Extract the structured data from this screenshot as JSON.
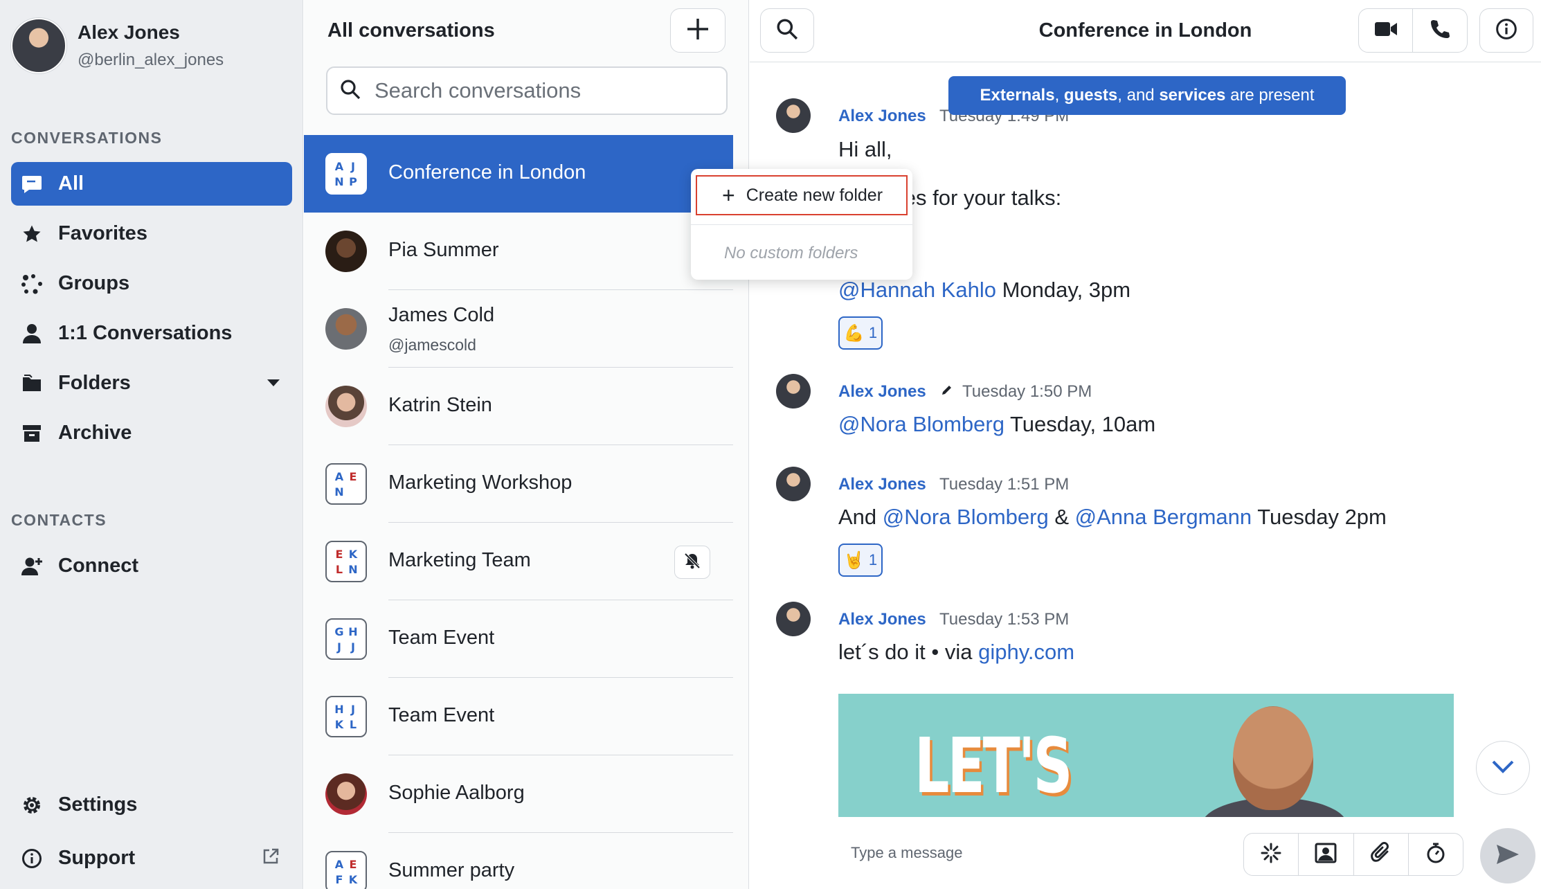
{
  "colors": {
    "accent": "#2d66c6",
    "highlight_box": "#d9412f"
  },
  "profile": {
    "name": "Alex Jones",
    "handle": "@berlin_alex_jones"
  },
  "sidebar": {
    "conversations_label": "CONVERSATIONS",
    "contacts_label": "CONTACTS",
    "items": [
      {
        "label": "All",
        "icon": "chat-bubble-icon",
        "active": true
      },
      {
        "label": "Favorites",
        "icon": "star-icon"
      },
      {
        "label": "Groups",
        "icon": "groups-dots-icon"
      },
      {
        "label": "1:1 Conversations",
        "icon": "person-icon"
      },
      {
        "label": "Folders",
        "icon": "folder-icon"
      },
      {
        "label": "Archive",
        "icon": "archive-box-icon"
      }
    ],
    "contacts": [
      {
        "label": "Connect",
        "icon": "add-person-icon"
      }
    ],
    "settings_label": "Settings",
    "support_label": "Support"
  },
  "list": {
    "title": "All conversations",
    "search_placeholder": "Search conversations",
    "conversations": [
      {
        "name": "Conference in London",
        "type": "group",
        "letters": [
          "A",
          "J",
          "N",
          "P"
        ],
        "active": true
      },
      {
        "name": "Pia Summer",
        "type": "person"
      },
      {
        "name": "James Cold",
        "type": "person",
        "sub": "@jamescold"
      },
      {
        "name": "Katrin Stein",
        "type": "person"
      },
      {
        "name": "Marketing Workshop",
        "type": "group",
        "letters": [
          "A",
          "E",
          "N",
          ""
        ]
      },
      {
        "name": "Marketing Team",
        "type": "group",
        "letters": [
          "E",
          "K",
          "L",
          "N"
        ],
        "muted": true
      },
      {
        "name": "Team Event",
        "type": "group",
        "letters": [
          "G",
          "H",
          "J",
          "J"
        ]
      },
      {
        "name": "Team Event",
        "type": "group",
        "letters": [
          "H",
          "J",
          "K",
          "L"
        ]
      },
      {
        "name": "Sophie Aalborg",
        "type": "person"
      },
      {
        "name": "Summer party",
        "type": "group",
        "letters": [
          "A",
          "E",
          "F",
          "K"
        ]
      }
    ]
  },
  "context_menu": {
    "create_label": "Create new folder",
    "empty_label": "No custom folders"
  },
  "chat": {
    "title": "Conference in London",
    "banner": {
      "part1": "Externals",
      "sep1": ", ",
      "part2": "guests",
      "sep2": ", and ",
      "part3": "services",
      "tail": " are present"
    },
    "messages": [
      {
        "author": "Alex Jones",
        "time": "Tuesday 1:49 PM",
        "line1": "Hi all,",
        "line2": "the dates for your talks:",
        "mention": "@Hannah Kahlo",
        "rest": " Monday, 3pm",
        "reaction_count": "1",
        "reaction_emoji": "💪"
      },
      {
        "author": "Alex Jones",
        "time": "Tuesday 1:50 PM",
        "mention": "@Nora Blomberg",
        "rest": " Tuesday, 10am"
      },
      {
        "author": "Alex Jones",
        "time": "Tuesday 1:51 PM",
        "pre": "And ",
        "mention1": "@Nora Blomberg",
        "mid": " & ",
        "mention2": "@Anna Bergmann",
        "rest": " Tuesday 2pm",
        "reaction_count": "1",
        "reaction_emoji": "🤘"
      },
      {
        "author": "Alex Jones",
        "time": "Tuesday 1:53 PM",
        "text": "let´s do it • via ",
        "link": "giphy.com",
        "gif_text": "LET'S"
      }
    ],
    "composer_placeholder": "Type a message"
  }
}
